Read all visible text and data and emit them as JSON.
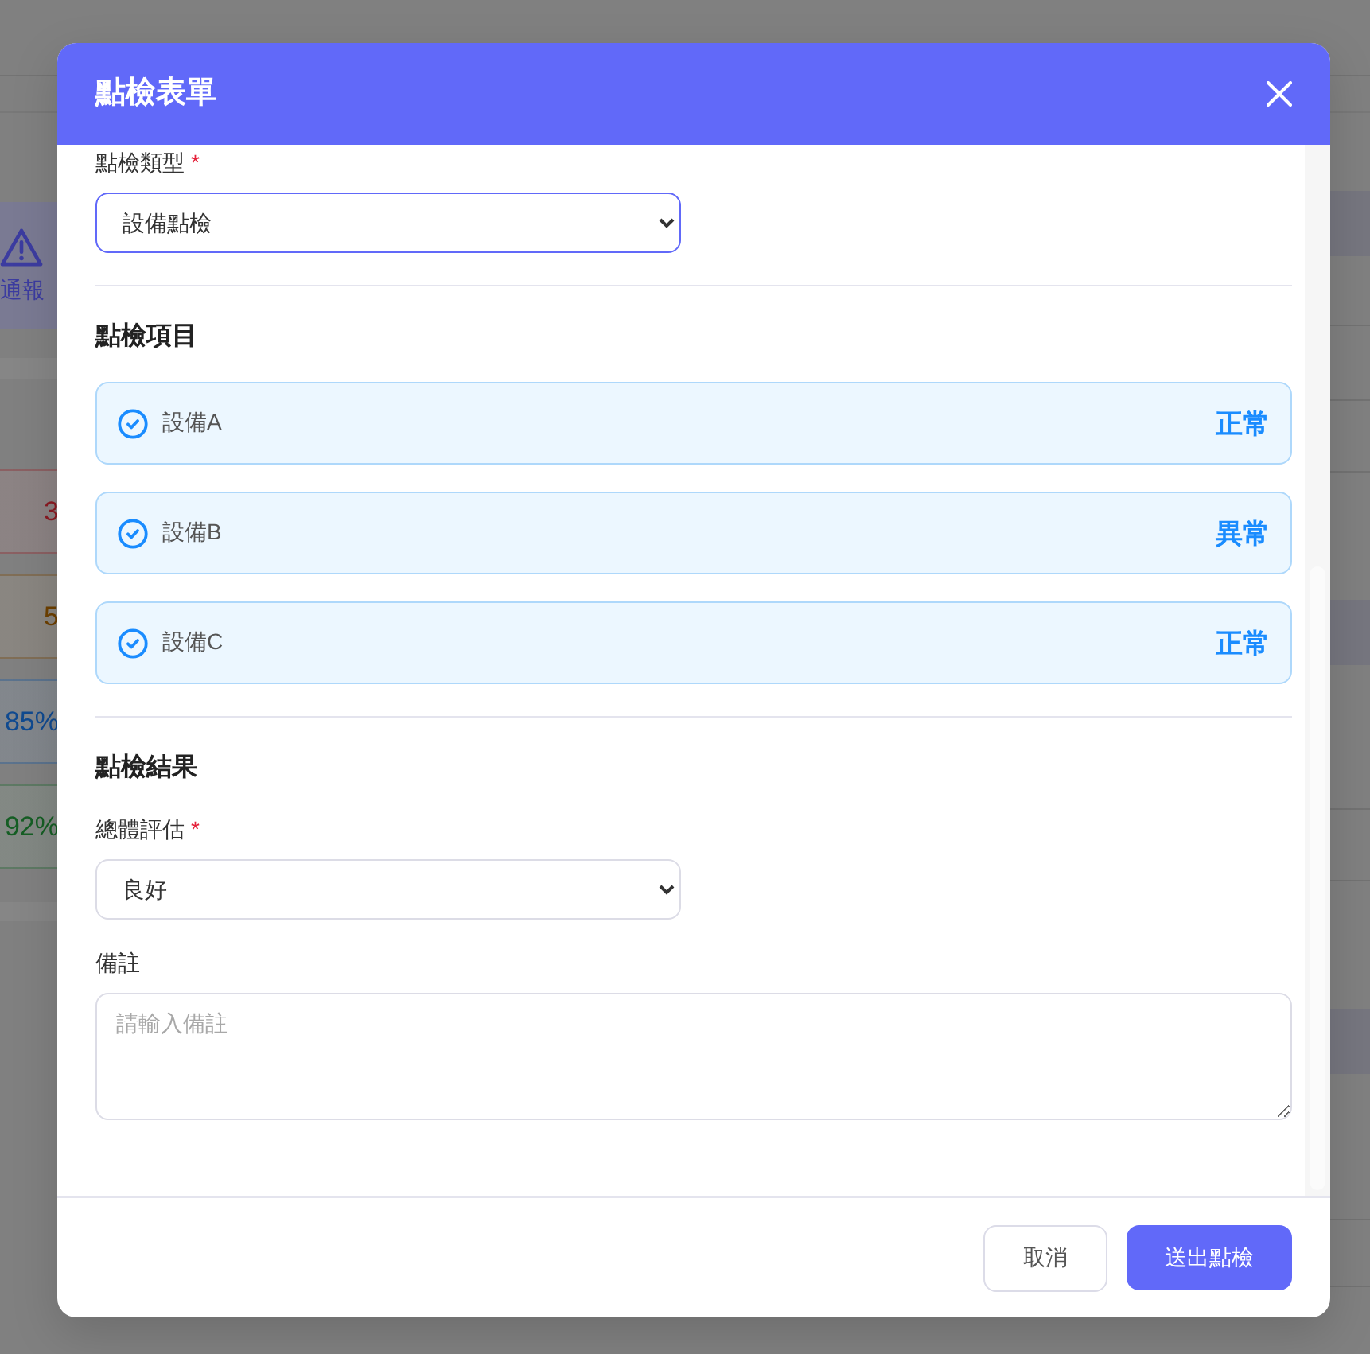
{
  "background_page": {
    "alert_card": {
      "label": "通報"
    },
    "stats": [
      {
        "value": "3",
        "color": "#8a1a22"
      },
      {
        "value": "5",
        "color": "#6e4000"
      },
      {
        "value": "85%",
        "color": "#104a90"
      },
      {
        "value": "92%",
        "color": "#155e24"
      }
    ]
  },
  "dialog": {
    "title": "點檢表單",
    "inspection_type": {
      "label": "點檢類型",
      "required_mark": "*",
      "value": "設備點檢",
      "focused": true
    },
    "items_section": {
      "heading": "點檢項目",
      "items": [
        {
          "name": "設備A",
          "status": "正常",
          "checked": true
        },
        {
          "name": "設備B",
          "status": "異常",
          "checked": true
        },
        {
          "name": "設備C",
          "status": "正常",
          "checked": true
        }
      ]
    },
    "result_section": {
      "heading": "點檢結果",
      "overall": {
        "label": "總體評估",
        "required_mark": "*",
        "value": "良好",
        "focused": false
      },
      "remarks": {
        "label": "備註",
        "placeholder": "請輸入備註"
      }
    },
    "buttons": [
      {
        "label": "取消",
        "kind": "secondary"
      },
      {
        "label": "送出點檢",
        "kind": "primary"
      }
    ]
  }
}
